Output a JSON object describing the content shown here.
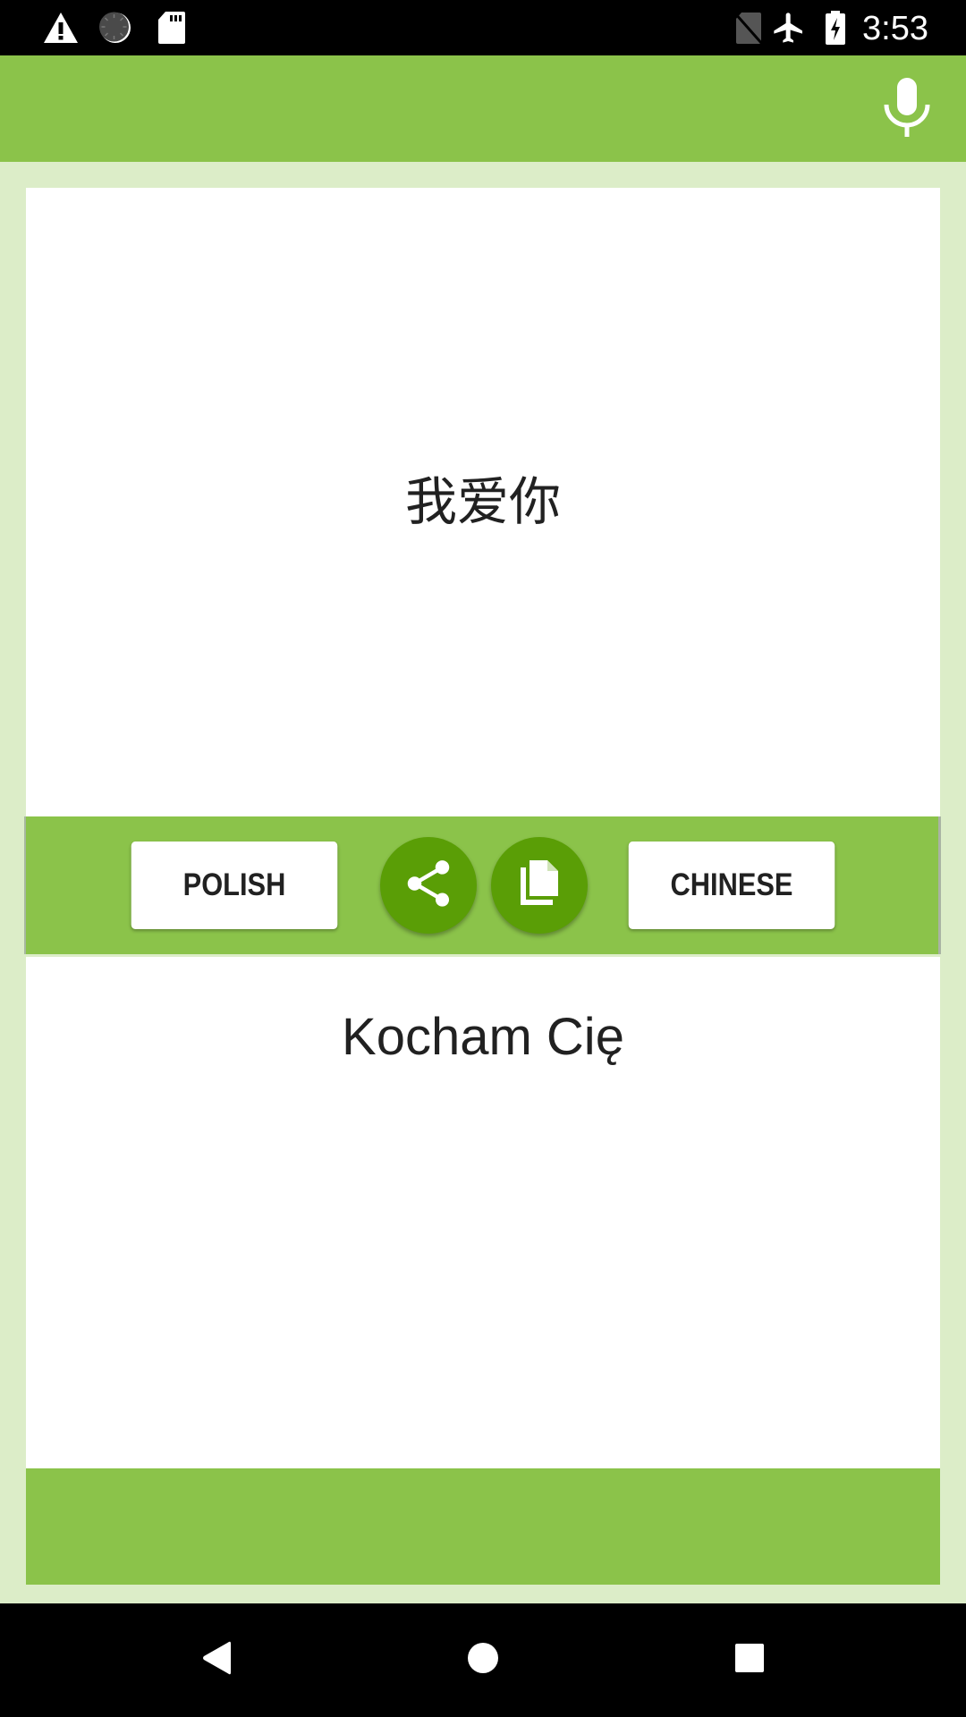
{
  "status_bar": {
    "time": "3:53",
    "left_icons": [
      "warning-icon",
      "sync-progress-icon",
      "sd-card-icon"
    ],
    "right_icons": [
      "no-sim-icon",
      "airplane-mode-icon",
      "battery-charging-icon"
    ]
  },
  "app_bar": {
    "actions": [
      "mic-icon"
    ]
  },
  "source_panel": {
    "text": "我爱你"
  },
  "controls": {
    "source_language": "POLISH",
    "target_language": "CHINESE",
    "share_icon": "share-icon",
    "copy_icon": "copy-icon"
  },
  "target_panel": {
    "text": "Kocham Cię"
  },
  "colors": {
    "primary": "#8BC34A",
    "primary_dark": "#5A9E06",
    "background": "#DCEDC8",
    "text": "#212121"
  },
  "nav_bar": {
    "buttons": [
      "back-icon",
      "home-icon",
      "recents-icon"
    ]
  }
}
